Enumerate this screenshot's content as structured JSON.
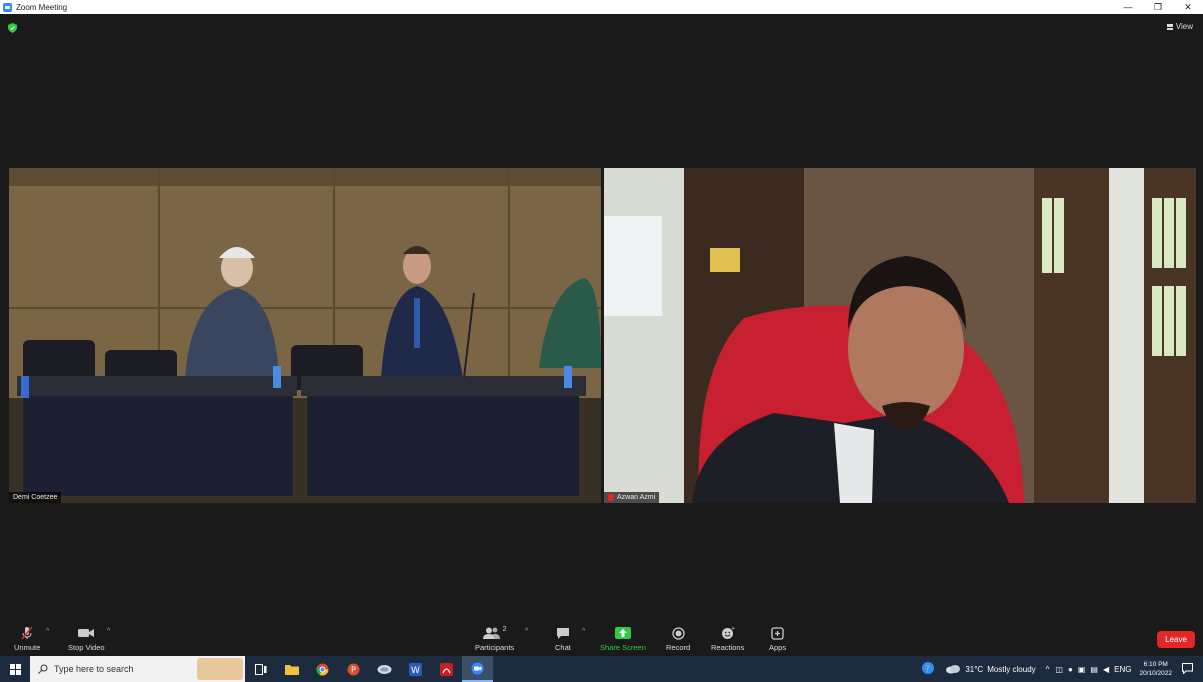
{
  "window": {
    "title": "Zoom Meeting"
  },
  "header": {
    "view_label": "View"
  },
  "participants_tiles": [
    {
      "name": "Demi Coetzee"
    },
    {
      "name": "Azwan Azmi"
    }
  ],
  "toolbar": {
    "unmute_label": "Unmute",
    "stop_video_label": "Stop Video",
    "participants_label": "Participants",
    "participants_count": "2",
    "chat_label": "Chat",
    "share_screen_label": "Share Screen",
    "record_label": "Record",
    "reactions_label": "Reactions",
    "apps_label": "Apps",
    "leave_label": "Leave"
  },
  "taskbar": {
    "search_placeholder": "Type here to search",
    "weather_temp": "31°C",
    "weather_desc": "Mostly cloudy",
    "language": "ENG",
    "time": "6:10 PM",
    "date": "20/10/2022"
  },
  "colors": {
    "leave": "#e02828",
    "share": "#2ecc40",
    "zoom_blue": "#2d8cff",
    "taskbar": "#1c2b3e"
  }
}
